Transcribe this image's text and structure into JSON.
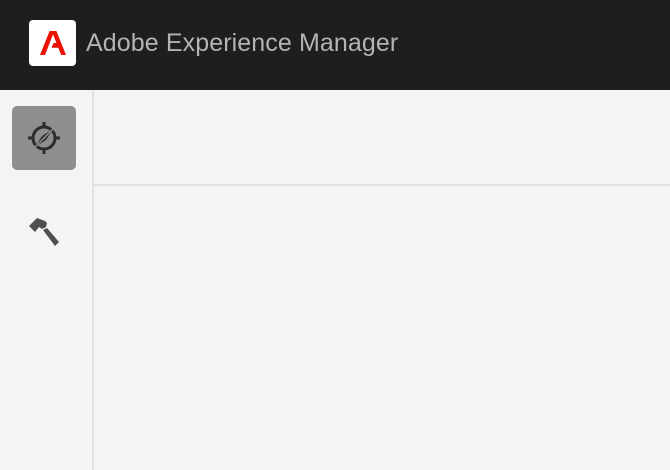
{
  "header": {
    "app_title": "Adobe Experience Manager",
    "logo_icon": "adobe-logo-icon",
    "background": "#1e1e1e",
    "logo_color": "#eb1000"
  },
  "rail": {
    "items": [
      {
        "icon": "compass-icon",
        "selected": true
      },
      {
        "icon": "hammer-icon",
        "selected": false
      }
    ]
  },
  "colors": {
    "selected_bg": "#8e8e8e",
    "surface": "#f4f4f4",
    "divider": "#e1e1e1"
  }
}
